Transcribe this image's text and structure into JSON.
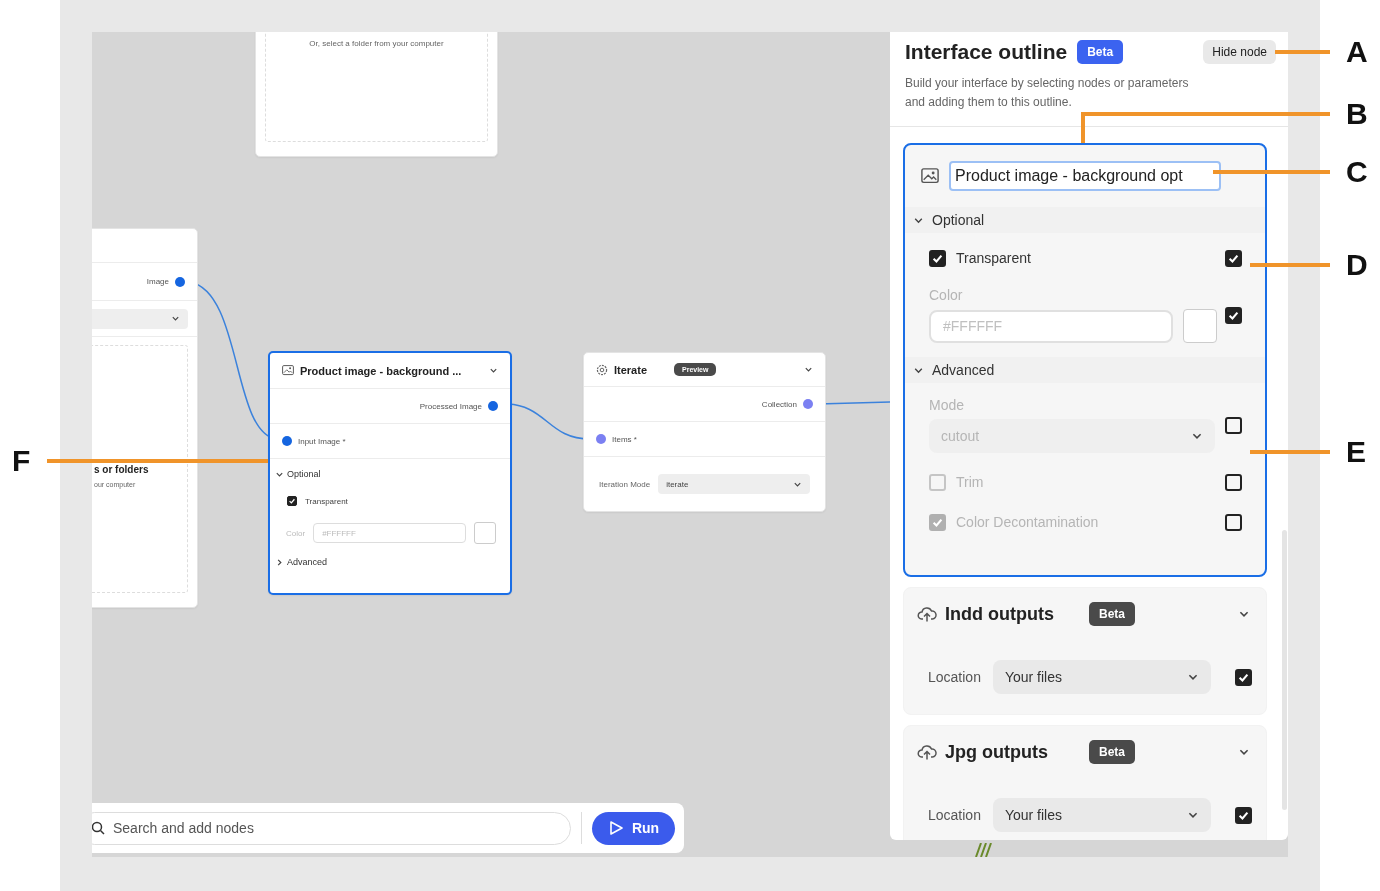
{
  "canvas": {
    "nodes": [
      {
        "kind": "upload",
        "selected": false,
        "hint": "Or, select a folder from your computer"
      },
      {
        "kind": "source",
        "selected": false,
        "output": "Image",
        "upload_title": "s or folders",
        "upload_hint": "our computer"
      },
      {
        "kind": "process",
        "selected": true,
        "title": "Product image - background ...",
        "output": "Processed Image",
        "input": "Input Image *",
        "sections": [
          {
            "title": "Optional",
            "expanded": true,
            "fields": [
              {
                "kind": "checkbox",
                "label": "Transparent",
                "checked": true
              },
              {
                "kind": "color",
                "label": "Color",
                "placeholder": "#FFFFFF"
              }
            ]
          },
          {
            "title": "Advanced",
            "expanded": false
          }
        ]
      },
      {
        "kind": "iterate",
        "selected": false,
        "title": "Iterate",
        "badge": "Preview",
        "output": "Collection",
        "input": "Items *",
        "field": {
          "label": "Iteration Mode",
          "value": "iterate"
        }
      }
    ]
  },
  "toolbar": {
    "search_placeholder": "Search and add nodes",
    "run": "Run"
  },
  "outline": {
    "title": "Interface outline",
    "badge": "Beta",
    "hide_button": "Hide node",
    "description": "Build your interface by selecting nodes or parameters and adding them to this outline.",
    "node": {
      "selected": true,
      "name_value": "Product image - background opt",
      "sections": [
        {
          "title": "Optional",
          "expanded": true,
          "params": [
            {
              "kind": "checkbox",
              "label": "Transparent",
              "checked": true,
              "disabled": false,
              "included": true
            },
            {
              "kind": "color",
              "label": "Color",
              "placeholder": "#FFFFFF",
              "disabled": true,
              "included": true
            }
          ]
        },
        {
          "title": "Advanced",
          "expanded": true,
          "params": [
            {
              "kind": "select",
              "label": "Mode",
              "value": "cutout",
              "disabled": true,
              "included": false
            },
            {
              "kind": "checkbox",
              "label": "Trim",
              "checked": false,
              "disabled": true,
              "included": false
            },
            {
              "kind": "checkbox",
              "label": "Color Decontamination",
              "checked": true,
              "disabled": true,
              "included": false
            }
          ]
        }
      ]
    },
    "outputs": [
      {
        "title": "Indd outputs",
        "badge": "Beta",
        "field_label": "Location",
        "value": "Your files",
        "included": true
      },
      {
        "title": "Jpg outputs",
        "badge": "Beta",
        "field_label": "Location",
        "value": "Your files",
        "included": true
      }
    ]
  },
  "callouts": [
    {
      "label": "A"
    },
    {
      "label": "B"
    },
    {
      "label": "C"
    },
    {
      "label": "D"
    },
    {
      "label": "F"
    },
    {
      "label": "E"
    }
  ]
}
